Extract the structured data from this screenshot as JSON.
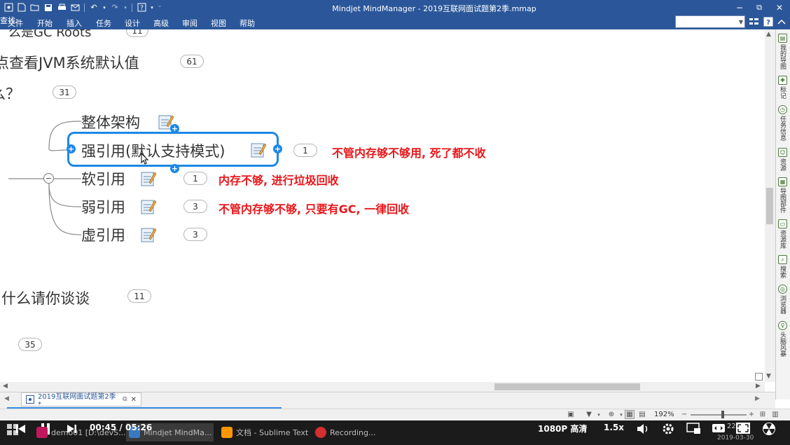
{
  "window": {
    "title": "Mindjet MindManager - 2019互联网面试题第2季.mmap",
    "controls": {
      "minimize": "−",
      "restore": "⧉",
      "close": "✕"
    }
  },
  "quick_access": [
    "new-icon",
    "open-icon",
    "save-icon",
    "print-icon",
    "undo-icon",
    "redo-icon",
    "help-icon"
  ],
  "ribbon": {
    "tabs": [
      "文件",
      "开始",
      "插入",
      "任务",
      "设计",
      "高级",
      "审阅",
      "视图",
      "帮助"
    ],
    "search_label": "查找:",
    "search_value": ""
  },
  "map": {
    "partial_topics": [
      {
        "text": "么是GC Roots",
        "badge": "11"
      },
      {
        "text": "查看JVM系统默认值",
        "prefix": "点",
        "badge": "61"
      },
      {
        "text": "？",
        "prefix": "么",
        "badge": "31"
      },
      {
        "text": "？"
      },
      {
        "text": "什么请你谈谈",
        "badge": "11"
      },
      {
        "badge": "35"
      }
    ],
    "subtopics": [
      {
        "text": "整体架构",
        "badge": "",
        "note": ""
      },
      {
        "text": "强引用(默认支持模式)",
        "badge": "1",
        "note": "不管内存够不够用, 死了都不收"
      },
      {
        "text": "软引用",
        "badge": "1",
        "note": "内存不够, 进行垃圾回收"
      },
      {
        "text": "弱引用",
        "badge": "3",
        "note": "不管内存够不够, 只要有GC, 一律回收"
      },
      {
        "text": "虚引用",
        "badge": "3",
        "note": ""
      }
    ],
    "collapse_symbol": "−",
    "selected_index": 1
  },
  "sidebar": [
    {
      "icon": "my-map-icon",
      "label": "我的导图"
    },
    {
      "icon": "marker-icon",
      "label": "标记"
    },
    {
      "icon": "task-info-icon",
      "label": "任务信息"
    },
    {
      "icon": "resource-icon",
      "label": "资源"
    },
    {
      "icon": "map-parts-icon",
      "label": "导图部件"
    },
    {
      "icon": "library-icon",
      "label": "资源库"
    },
    {
      "icon": "search-icon",
      "label": "搜索"
    },
    {
      "icon": "browser-icon",
      "label": "浏览器"
    },
    {
      "icon": "brainstorm-icon",
      "label": "头脑风暴"
    }
  ],
  "document_tab": {
    "label": "2019互联网面试题第2季*"
  },
  "status": {
    "zoom": "192%"
  },
  "player": {
    "current_time": "00:45",
    "separator": "/",
    "total_time": "05:26",
    "quality": "1080P 高清",
    "speed": "1.5x",
    "clock_time": "22:",
    "clock_date": "2019-03-30"
  },
  "taskbar": [
    {
      "label": "demo01 [D:\\devS...",
      "icon": "intellij-icon"
    },
    {
      "label": "Mindjet MindMa...",
      "icon": "mindmanager-icon"
    },
    {
      "label": "文档 - Sublime Text",
      "icon": "sublime-icon"
    },
    {
      "label": "Recording...",
      "icon": "recording-icon"
    }
  ],
  "colors": {
    "ribbon": "#2b579a",
    "selection": "#1e88e5",
    "note_text": "#e8171b"
  }
}
